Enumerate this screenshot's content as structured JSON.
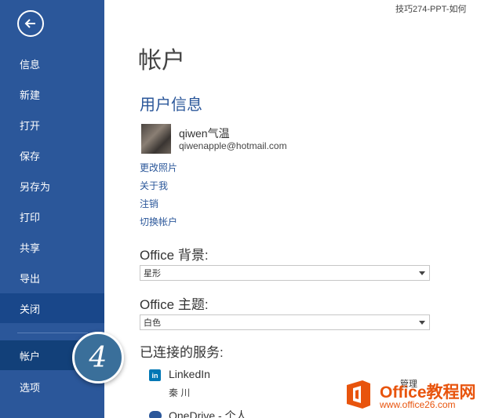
{
  "window": {
    "title": "技巧274-PPT-如何"
  },
  "sidebar": {
    "items": [
      {
        "label": "信息"
      },
      {
        "label": "新建"
      },
      {
        "label": "打开"
      },
      {
        "label": "保存"
      },
      {
        "label": "另存为"
      },
      {
        "label": "打印"
      },
      {
        "label": "共享"
      },
      {
        "label": "导出"
      },
      {
        "label": "关闭"
      },
      {
        "label": "帐户"
      },
      {
        "label": "选项"
      }
    ]
  },
  "step_badge": "4",
  "main": {
    "page_title": "帐户",
    "user_info_title": "用户信息",
    "user": {
      "name": "qiwen气温",
      "email": "qiwenapple@hotmail.com"
    },
    "links": [
      "更改照片",
      "关于我",
      "注销",
      "切换帐户"
    ],
    "background": {
      "label": "Office 背景:",
      "value": "星形"
    },
    "theme": {
      "label": "Office 主题:",
      "value": "白色"
    },
    "services": {
      "title": "已连接的服务:",
      "linkedin": {
        "name": "LinkedIn",
        "user": "秦 川",
        "action": "管理"
      },
      "onedrive": {
        "name": "OneDrive - 个人"
      }
    }
  },
  "watermark": {
    "line1": "Office教程网",
    "line2": "www.office26.com"
  },
  "colors": {
    "sidebar": "#2b579a",
    "accent": "#2b579a",
    "watermark": "#e8540d"
  }
}
